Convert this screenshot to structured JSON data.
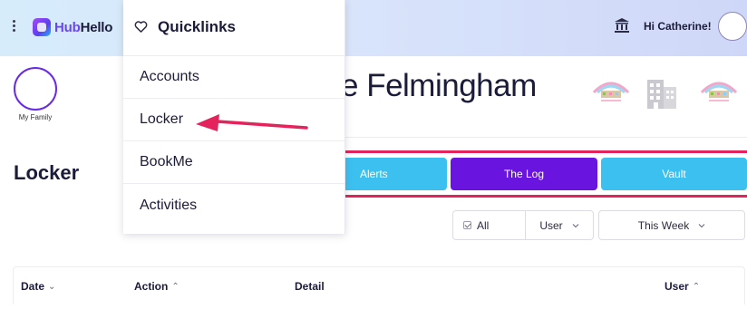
{
  "app": {
    "brand_part1": "Hub",
    "brand_part2": "Hello",
    "greeting": "Hi Catherine!"
  },
  "quicklinks": {
    "title": "Quicklinks",
    "items": [
      {
        "label": "Accounts"
      },
      {
        "label": "Locker"
      },
      {
        "label": "BookMe"
      },
      {
        "label": "Activities"
      }
    ]
  },
  "profile": {
    "my_family_label": "My Family",
    "page_heading": "e Felmingham"
  },
  "page": {
    "title": "Locker"
  },
  "tabs": [
    {
      "label": "Alerts"
    },
    {
      "label": "The Log"
    },
    {
      "label": "Vault"
    }
  ],
  "filters": {
    "all_label": "All",
    "user_label": "User",
    "period_label": "This Week"
  },
  "table": {
    "columns": [
      {
        "label": "Date",
        "sort": "down"
      },
      {
        "label": "Action",
        "sort": "up"
      },
      {
        "label": "Detail",
        "sort": ""
      },
      {
        "label": "User",
        "sort": "up"
      }
    ]
  },
  "colors": {
    "accent_purple": "#6a14e0",
    "tab_blue": "#3cc0f0",
    "highlight_red": "#e4225b"
  }
}
